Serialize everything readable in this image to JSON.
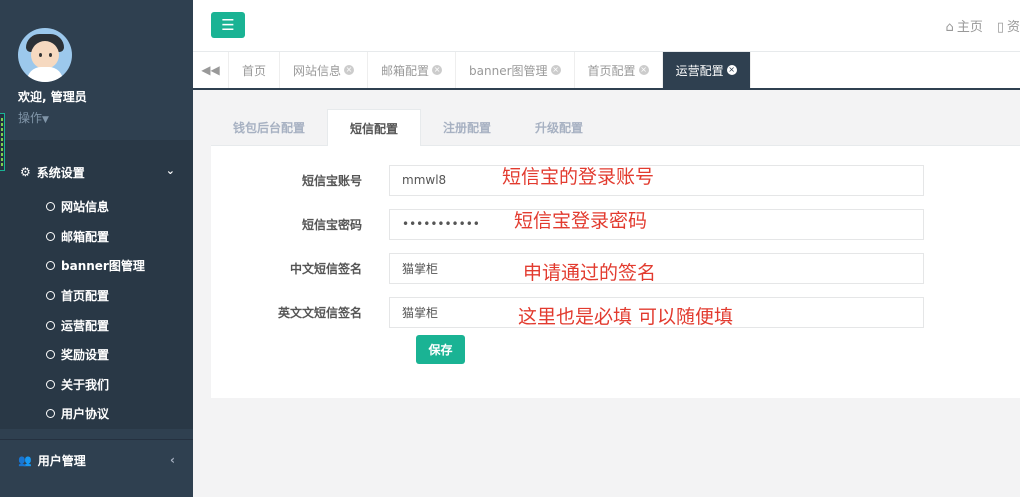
{
  "sidebar": {
    "welcome": "欢迎, 管理员",
    "ops": "操作",
    "group1": {
      "title": "系统设置",
      "items": [
        "网站信息",
        "邮箱配置",
        "banner图管理",
        "首页配置",
        "运营配置",
        "奖励设置",
        "关于我们",
        "用户协议"
      ]
    },
    "group2": {
      "title": "用户管理"
    }
  },
  "topbar": {
    "home": "主页",
    "second": "资"
  },
  "tabs": [
    {
      "label": "首页",
      "closable": false
    },
    {
      "label": "网站信息",
      "closable": true
    },
    {
      "label": "邮箱配置",
      "closable": true
    },
    {
      "label": "banner图管理",
      "closable": true
    },
    {
      "label": "首页配置",
      "closable": true
    },
    {
      "label": "运营配置",
      "closable": true,
      "active": true
    }
  ],
  "subtabs": [
    "钱包后台配置",
    "短信配置",
    "注册配置",
    "升级配置"
  ],
  "form": {
    "fields": [
      {
        "label": "短信宝账号",
        "value": "mmwl8"
      },
      {
        "label": "短信宝密码",
        "value": "•••••••••••"
      },
      {
        "label": "中文短信签名",
        "value": "猫掌柜"
      },
      {
        "label": "英文文短信签名",
        "value": "猫掌柜"
      }
    ],
    "save": "保存"
  },
  "annotations": [
    "短信宝的登录账号",
    "短信宝登录密码",
    "申请通过的签名",
    "这里也是必填  可以随便填"
  ],
  "colors": {
    "sidebar": "#2f4050",
    "accent": "#1ab394",
    "annotation": "#e23b2f"
  }
}
